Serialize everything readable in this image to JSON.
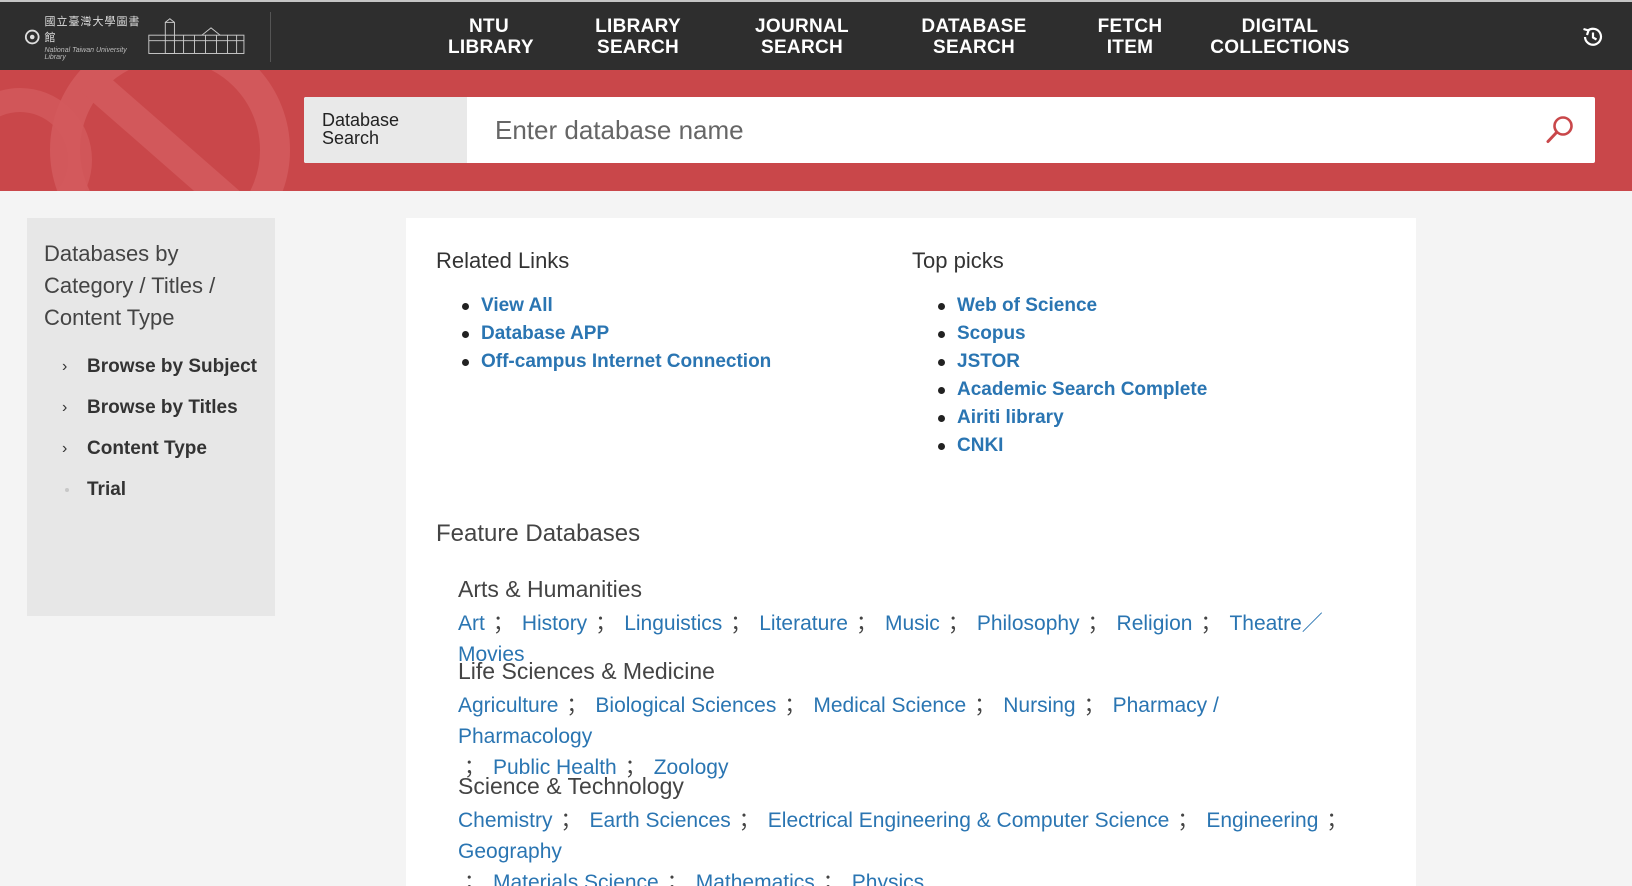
{
  "logo": {
    "title_zh": "國立臺灣大學圖書館",
    "title_en": "National Taiwan University Library"
  },
  "nav": [
    {
      "line1": "NTU",
      "line2": "LIBRARY"
    },
    {
      "line1": "LIBRARY",
      "line2": "SEARCH"
    },
    {
      "line1": "JOURNAL",
      "line2": "SEARCH"
    },
    {
      "line1": "DATABASE",
      "line2": "SEARCH"
    },
    {
      "line1": "FETCH",
      "line2": "ITEM"
    },
    {
      "line1": "DIGITAL",
      "line2": "COLLECTIONS"
    }
  ],
  "search": {
    "label_line1": "Database",
    "label_line2": "Search",
    "placeholder": "Enter database name"
  },
  "sidebar": {
    "title": "Databases by Category / Titles / Content Type",
    "items": [
      {
        "label": "Browse by Subject",
        "marker": "chevron"
      },
      {
        "label": "Browse by Titles",
        "marker": "chevron"
      },
      {
        "label": "Content Type",
        "marker": "chevron"
      },
      {
        "label": "Trial",
        "marker": "dot"
      }
    ]
  },
  "related_links": {
    "title": "Related Links",
    "items": [
      "View All",
      "Database APP",
      "Off-campus Internet Connection"
    ]
  },
  "top_picks": {
    "title": "Top picks",
    "items": [
      "Web of Science",
      "Scopus",
      "JSTOR",
      "Academic Search Complete",
      "Airiti library",
      "CNKI"
    ]
  },
  "features": {
    "title": "Feature Databases",
    "groups": [
      {
        "title": "Arts & Humanities",
        "lines": [
          [
            "Art",
            "History",
            "Linguistics",
            "Literature",
            "Music",
            "Philosophy",
            "Religion",
            "Theatre／Movies"
          ]
        ]
      },
      {
        "title": "Life Sciences & Medicine",
        "lines": [
          [
            "Agriculture",
            "Biological Sciences",
            "Medical Science",
            "Nursing",
            "Pharmacy / Pharmacology"
          ],
          [
            "Public Health",
            "Zoology"
          ]
        ]
      },
      {
        "title": "Science & Technology",
        "lines": [
          [
            "Chemistry",
            "Earth Sciences",
            "Electrical Engineering & Computer Science",
            "Engineering",
            "Geography"
          ],
          [
            "Materials Science",
            "Mathematics",
            "Physics"
          ]
        ]
      }
    ],
    "separator": "；"
  },
  "colors": {
    "topbar": "#2e2e2e",
    "banner": "#c9474a",
    "link": "#2a75b2",
    "sidebar": "#e7e7e7"
  }
}
